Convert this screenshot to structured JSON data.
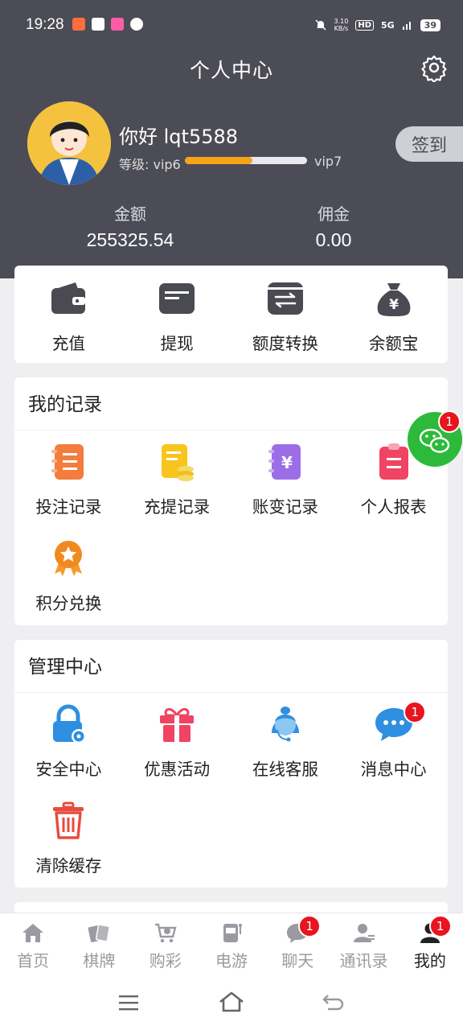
{
  "status_bar": {
    "time": "19:28",
    "net_speed_value": "3.10",
    "net_speed_unit": "KB/s",
    "hd": "HD",
    "signal": "5G",
    "battery": "39"
  },
  "header": {
    "title": "个人中心",
    "greeting": "你好 lqt5588",
    "level_label": "等级: vip6",
    "level_next": "vip7",
    "level_progress_percent": 55,
    "signin_label": "签到",
    "balance_label": "金额",
    "balance_value": "255325.54",
    "commission_label": "佣金",
    "commission_value": "0.00"
  },
  "quick_actions": [
    {
      "label": "充值",
      "icon": "wallet-icon"
    },
    {
      "label": "提现",
      "icon": "card-icon"
    },
    {
      "label": "额度转换",
      "icon": "transfer-icon"
    },
    {
      "label": "余额宝",
      "icon": "money-bag-icon"
    }
  ],
  "records": {
    "title": "我的记录",
    "items": [
      {
        "label": "投注记录",
        "icon": "bet-record-icon"
      },
      {
        "label": "充提记录",
        "icon": "deposit-record-icon"
      },
      {
        "label": "账变记录",
        "icon": "account-change-icon"
      },
      {
        "label": "个人报表",
        "icon": "report-icon"
      },
      {
        "label": "积分兑换",
        "icon": "medal-icon"
      }
    ]
  },
  "management": {
    "title": "管理中心",
    "items": [
      {
        "label": "安全中心",
        "icon": "lock-icon"
      },
      {
        "label": "优惠活动",
        "icon": "gift-icon"
      },
      {
        "label": "在线客服",
        "icon": "support-agent-icon"
      },
      {
        "label": "消息中心",
        "icon": "chat-bubble-icon",
        "badge": "1"
      },
      {
        "label": "清除缓存",
        "icon": "trash-icon"
      }
    ]
  },
  "floating_wechat": {
    "badge": "1"
  },
  "tabbar": [
    {
      "label": "首页",
      "icon": "home-icon"
    },
    {
      "label": "棋牌",
      "icon": "cards-icon"
    },
    {
      "label": "购彩",
      "icon": "lottery-cart-icon"
    },
    {
      "label": "电游",
      "icon": "slot-machine-icon"
    },
    {
      "label": "聊天",
      "icon": "chat-icon",
      "badge": "1"
    },
    {
      "label": "通讯录",
      "icon": "contacts-icon"
    },
    {
      "label": "我的",
      "icon": "profile-icon",
      "badge": "1",
      "active": true
    }
  ],
  "colors": {
    "header_bg": "#4c4c56",
    "accent": "#f5a31a",
    "badge": "#e8141e",
    "wechat": "#2dba3a"
  }
}
